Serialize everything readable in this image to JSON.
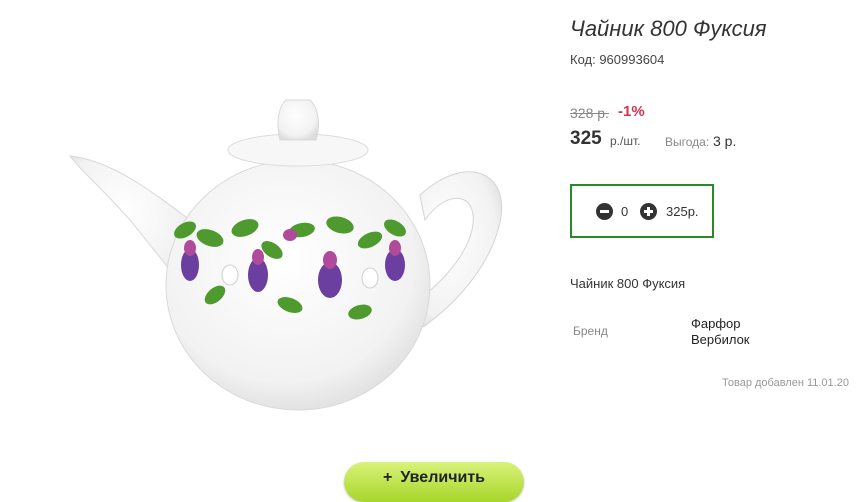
{
  "product": {
    "title": "Чайник 800 Фуксия",
    "code": "Код: 960993604",
    "image_alt": "teapot-photo"
  },
  "price": {
    "old": "328 р.",
    "discount": "-1%",
    "current": "325",
    "unit": "р./шт.",
    "benefit_label": "Выгода:",
    "benefit_value": "3 р."
  },
  "quantity": {
    "value": "0",
    "sum": "325р."
  },
  "description": "Чайник 800 Фуксия",
  "brand": {
    "label": "Бренд",
    "value": "Фарфор Вербилок"
  },
  "added": "Товар добавлен 11.01.20",
  "zoom_button": {
    "icon": "+",
    "label": "Увеличить"
  },
  "colors": {
    "accent_green": "#2a8a26",
    "discount_red": "#d0354e",
    "button_green": "#a8d62a"
  }
}
